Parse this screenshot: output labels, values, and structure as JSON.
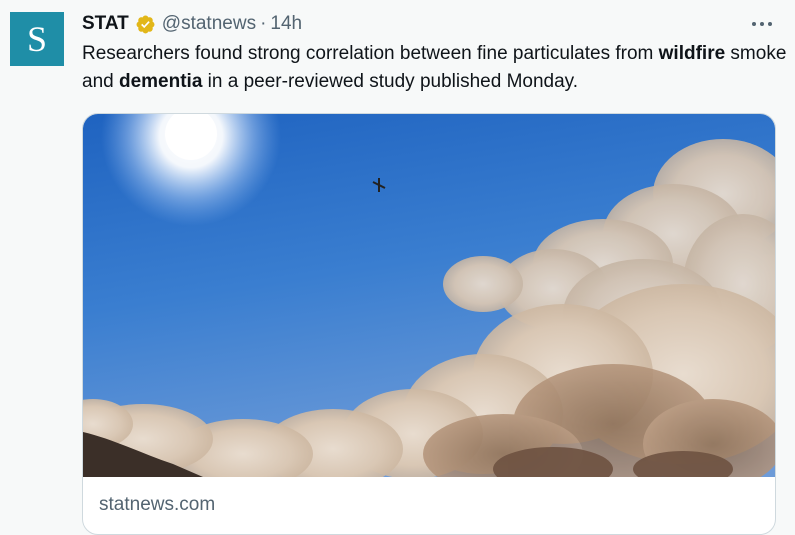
{
  "tweet": {
    "avatar_letter": "S",
    "author_name": "STAT",
    "author_handle": "@statnews",
    "separator": "·",
    "time": "14h",
    "text_parts": [
      "Researchers found strong correlation between fine particulates from ",
      "wildfire",
      " smoke and ",
      "dementia",
      " in a peer-reviewed study published Monday."
    ]
  },
  "card": {
    "domain": "statnews.com"
  },
  "icons": {
    "verified": "verified-badge-icon",
    "more": "more-options-icon"
  },
  "colors": {
    "avatar_bg": "#1f8ea7",
    "verified_gold": "#e2b719",
    "secondary_text": "#536471"
  }
}
